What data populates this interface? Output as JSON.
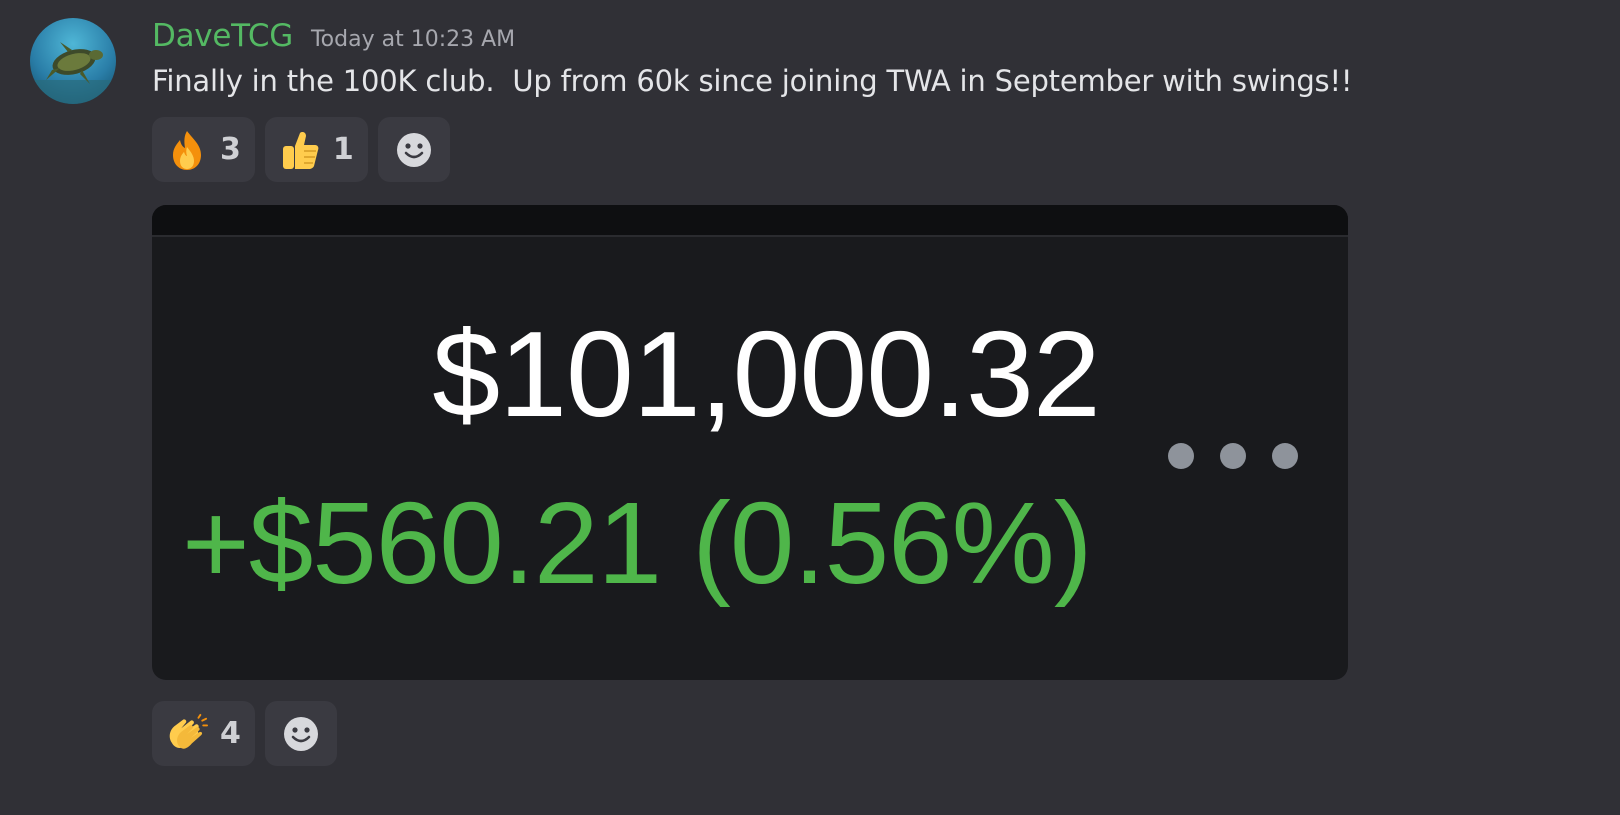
{
  "message": {
    "username": "DaveTCG",
    "timestamp": "Today at 10:23 AM",
    "text": "Finally in the 100K club.  Up from 60k since joining TWA in September with swings!!",
    "username_color": "#54b963"
  },
  "reactions_top": [
    {
      "emoji": "fire-icon",
      "count": "3"
    },
    {
      "emoji": "thumbs-up-icon",
      "count": "1"
    }
  ],
  "reactions_bottom": [
    {
      "emoji": "clapping-hands-icon",
      "count": "4"
    }
  ],
  "embed": {
    "balance": "$101,000.32",
    "change": "+$560.21 (0.56%)",
    "change_color": "#4fb64a"
  }
}
